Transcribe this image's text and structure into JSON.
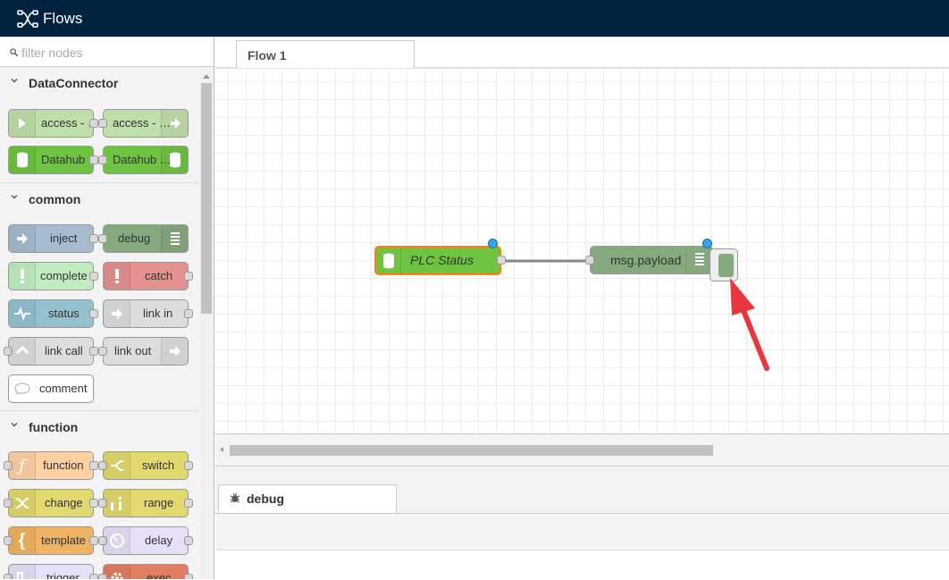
{
  "app": {
    "title": "Flows",
    "icon": "flows-logo-icon"
  },
  "palette": {
    "search_placeholder": "filter nodes",
    "categories": [
      {
        "label": "DataConnector",
        "nodes": [
          {
            "label": "access - …",
            "color": "#c0deaa",
            "icon": "arrow-in-icon"
          },
          {
            "label": "access - …",
            "color": "#c0deaa",
            "icon": "arrow-out-icon"
          },
          {
            "label": "Datahub …",
            "color": "#6ec341",
            "icon": "database-icon"
          },
          {
            "label": "Datahub …",
            "color": "#6ec341",
            "icon": "database-icon"
          }
        ]
      },
      {
        "label": "common",
        "nodes": [
          {
            "label": "inject",
            "color": "#a6bbcf",
            "icon": "inject-icon"
          },
          {
            "label": "debug",
            "color": "#87a980",
            "icon": "debug-list-icon"
          },
          {
            "label": "complete",
            "color": "#c0edc0",
            "icon": "exclamation-icon"
          },
          {
            "label": "catch",
            "color": "#e49191",
            "icon": "exclamation-icon"
          },
          {
            "label": "status",
            "color": "#94c1d0",
            "icon": "pulse-icon"
          },
          {
            "label": "link in",
            "color": "#dddddd",
            "icon": "link-in-icon"
          },
          {
            "label": "link call",
            "color": "#dddddd",
            "icon": "link-call-icon"
          },
          {
            "label": "link out",
            "color": "#dddddd",
            "icon": "link-out-icon"
          },
          {
            "label": "comment",
            "color": "#ffffff",
            "icon": "comment-icon"
          }
        ]
      },
      {
        "label": "function",
        "nodes": [
          {
            "label": "function",
            "color": "#fdd0a2",
            "icon": "function-icon"
          },
          {
            "label": "switch",
            "color": "#e2d96e",
            "icon": "switch-icon"
          },
          {
            "label": "change",
            "color": "#e2d96e",
            "icon": "shuffle-icon"
          },
          {
            "label": "range",
            "color": "#e2d96e",
            "icon": "range-icon"
          },
          {
            "label": "template",
            "color": "#f0b363",
            "icon": "brace-icon"
          },
          {
            "label": "delay",
            "color": "#e6e0f8",
            "icon": "timer-icon"
          },
          {
            "label": "trigger",
            "color": "#e6e0f8",
            "icon": "trigger-icon"
          },
          {
            "label": "exec",
            "color": "#e17e62",
            "icon": "gear-icon"
          }
        ]
      }
    ]
  },
  "workspace": {
    "tab_label": "Flow 1"
  },
  "flow": {
    "nodes": [
      {
        "label": "PLC Status",
        "color": "#6ec341",
        "icon": "database-icon",
        "selected": true
      },
      {
        "label": "msg.payload",
        "color": "#87a980",
        "icon": "debug-list-icon"
      }
    ]
  },
  "sidebar": {
    "tab_label": "debug",
    "icon": "bug-icon"
  },
  "colors": {
    "header": "#012340",
    "selection": "#ff7f0e",
    "annotation_arrow": "#e8363f",
    "changed_dot": "#3aa3e3"
  }
}
